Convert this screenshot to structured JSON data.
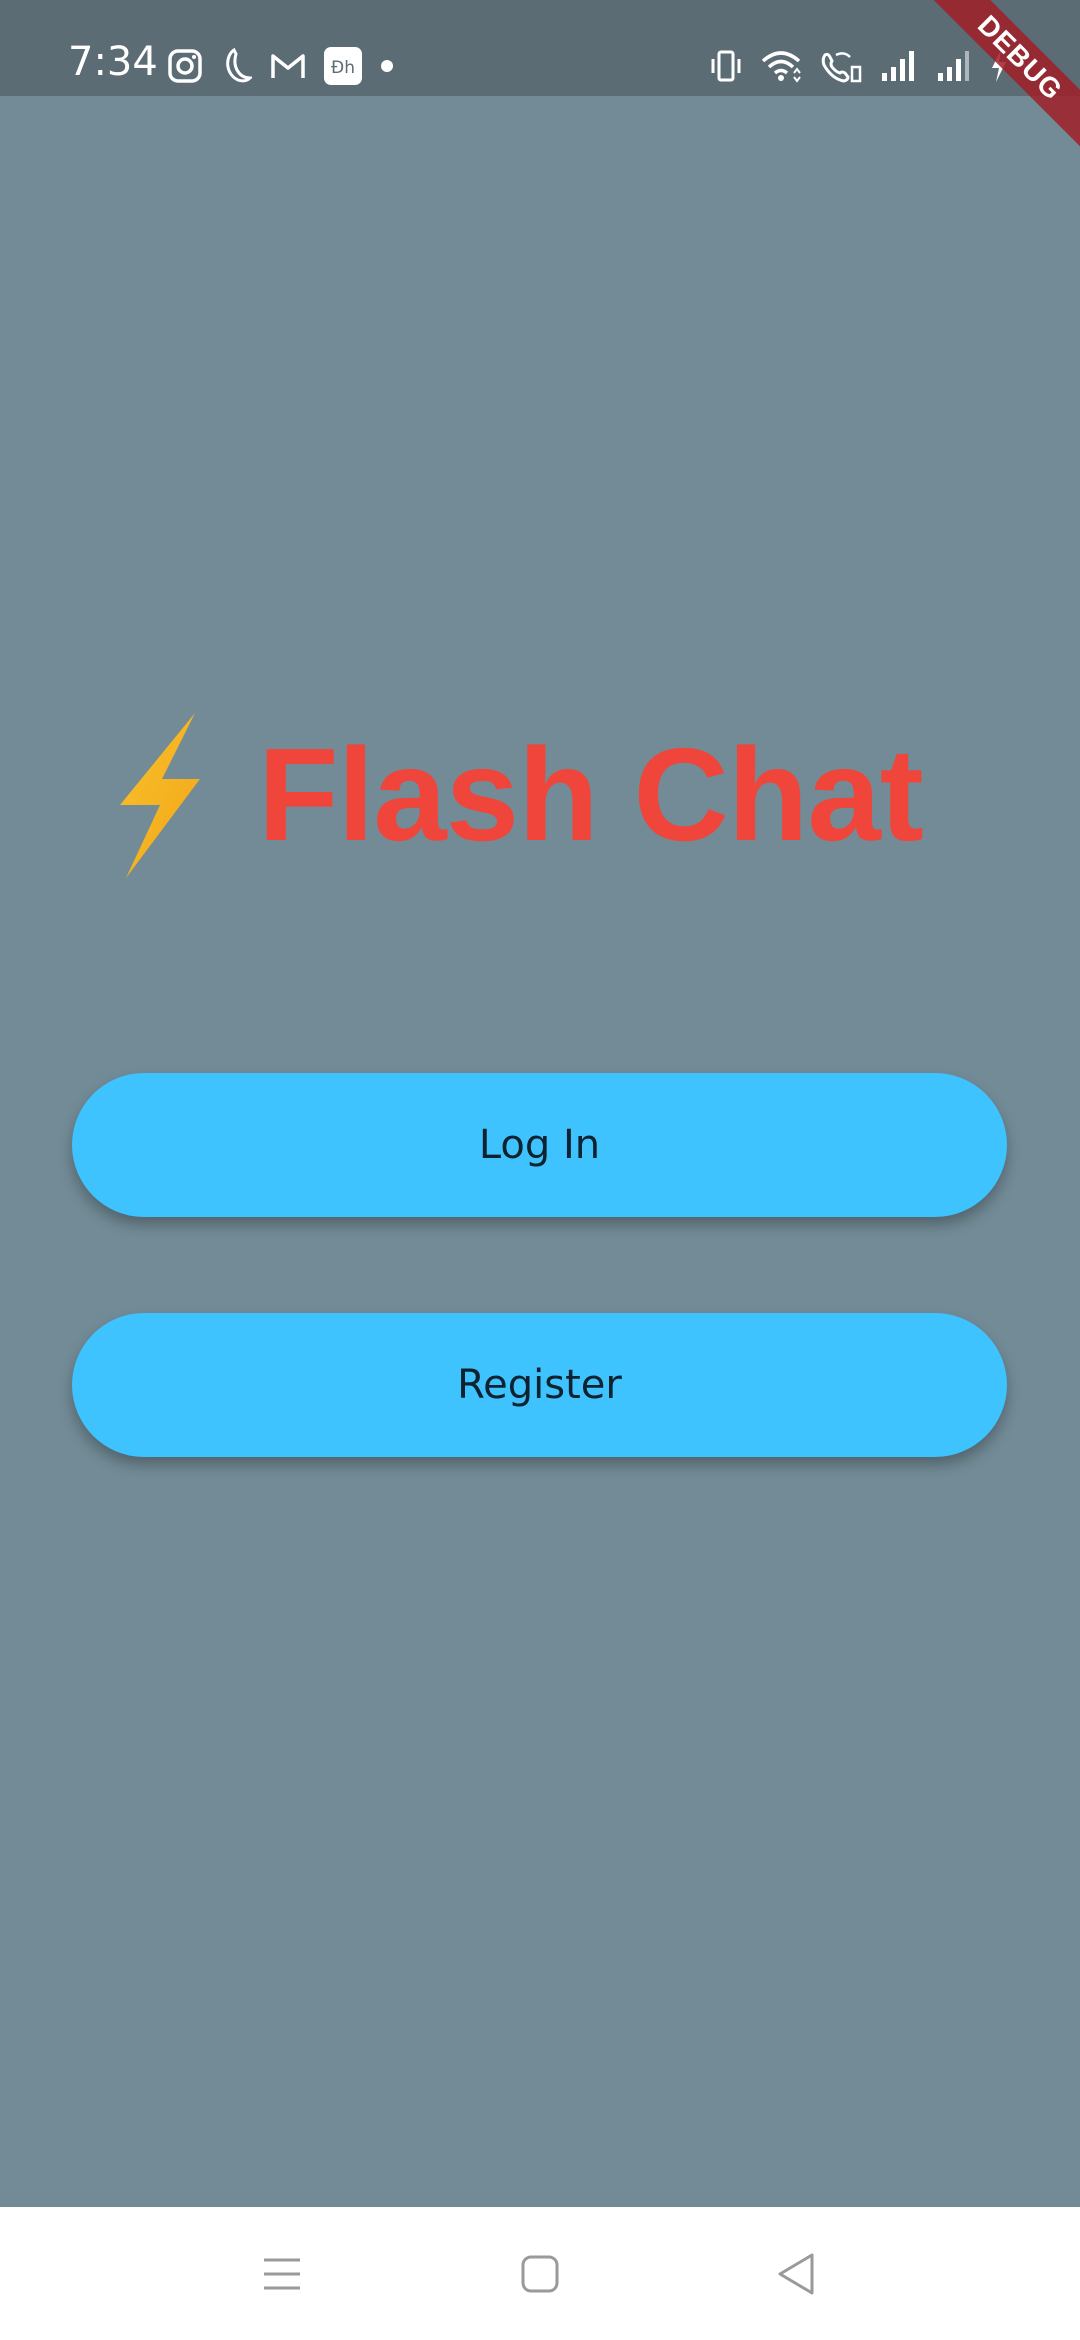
{
  "status_bar": {
    "time": "7:34",
    "left_icons": [
      "instagram-icon",
      "moon-icon",
      "gmail-icon",
      "disney-hotstar-icon",
      "notification-dot-icon"
    ],
    "right_icons": [
      "vibrate-icon",
      "wifi-icon",
      "wifi-calling-icon",
      "signal-icon",
      "signal-icon-2",
      "battery-icon"
    ]
  },
  "debug_banner": "DEBUG",
  "logo": {
    "icon": "lightning-bolt-icon",
    "title": "Flash Chat"
  },
  "buttons": {
    "login_label": "Log In",
    "register_label": "Register"
  },
  "nav_bar": {
    "icons": [
      "menu-icon",
      "home-icon",
      "back-icon"
    ]
  },
  "colors": {
    "background": "#728b96",
    "status_bar": "#5b6c75",
    "title": "#f0453a",
    "button": "#3fc3fe",
    "bolt": "#f7b52a"
  }
}
